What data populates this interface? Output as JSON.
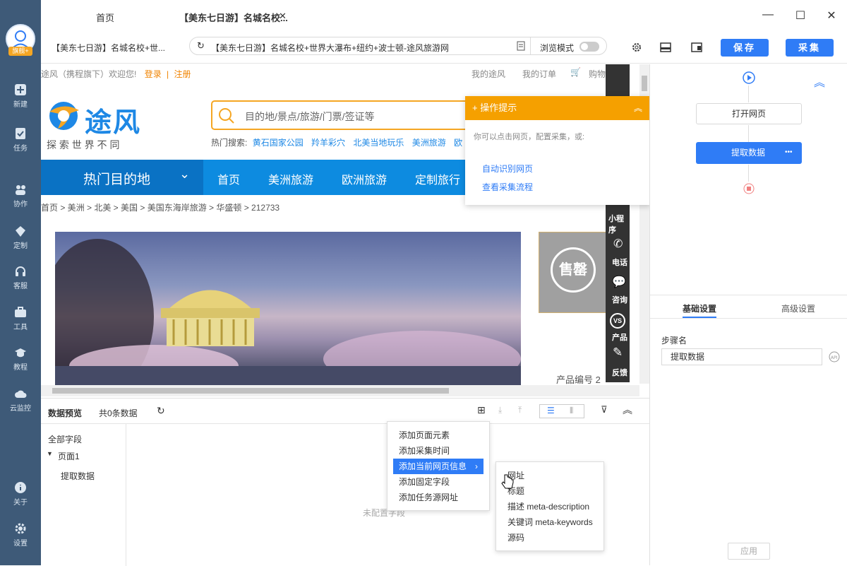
{
  "sidebar": {
    "badge": "旗舰+",
    "items": [
      {
        "label": "新建"
      },
      {
        "label": "任务"
      },
      {
        "label": "协作"
      },
      {
        "label": "定制"
      },
      {
        "label": "客服"
      },
      {
        "label": "工具"
      },
      {
        "label": "教程"
      },
      {
        "label": "云监控"
      }
    ],
    "bottom": [
      {
        "label": "关于"
      },
      {
        "label": "设置"
      }
    ]
  },
  "tabs": {
    "home": "首页",
    "active": "【美东七日游】名城名校...",
    "close": "✕"
  },
  "address": {
    "page_title": "【美东七日游】名城名校+世...",
    "url_text": "【美东七日游】名城名校+世界大瀑布+纽约+波士顿-途风旅游网",
    "browse_mode": "浏览模式",
    "save": "保存",
    "collect": "采集"
  },
  "website": {
    "welcome": "途风（携程旗下）欢迎您!",
    "login": "登录",
    "sep": "|",
    "register": "注册",
    "my_tufeng": "我的途风",
    "my_orders": "我的订单",
    "cart": "购物",
    "logo_text": "途风",
    "slogan": "探 索 世 界 不 同",
    "search_placeholder": "目的地/景点/旅游/门票/签证等",
    "hot_label": "热门搜索:",
    "hot_items": [
      "黄石国家公园",
      "羚羊彩穴",
      "北美当地玩乐",
      "美洲旅游",
      "欧"
    ],
    "nav_hot": "热门目的地",
    "nav_items": [
      "首页",
      "美洲旅游",
      "欧洲旅游",
      "定制旅行"
    ],
    "breadcrumb": "首页 > 美洲 > 北美 > 美国 > 美国东海岸旅游 > 华盛顿 > 212733",
    "soldout": "售罄",
    "product_no": "产品编号 2",
    "float_items": [
      "小程序",
      "电话",
      "咨询",
      "产品",
      "反馈"
    ]
  },
  "tips": {
    "title": "+ 操作提示",
    "desc": "你可以点击网页，配置采集，或:",
    "link1": "自动识别网页",
    "link2": "查看采集流程"
  },
  "flow": {
    "step1": "打开网页",
    "step2": "提取数据",
    "more": "•••"
  },
  "settings": {
    "tab_basic": "基础设置",
    "tab_advanced": "高级设置",
    "step_name_label": "步骤名",
    "step_name_value": "提取数据",
    "apply": "应用"
  },
  "preview": {
    "title": "数据预览",
    "count": "共0条数据",
    "all_fields": "全部字段",
    "page1": "页面1",
    "extract": "提取数据",
    "empty": "未配置字段"
  },
  "menu1": [
    "添加页面元素",
    "添加采集时间",
    "添加当前网页信息",
    "添加固定字段",
    "添加任务源网址"
  ],
  "menu2": [
    "网址",
    "标题",
    "描述 meta-description",
    "关键词 meta-keywords",
    "源码"
  ],
  "colors": {
    "accent": "#2f7cf6",
    "sidebar": "#3e5a78",
    "orange": "#f5a000",
    "nav_blue": "#0d8be0"
  }
}
